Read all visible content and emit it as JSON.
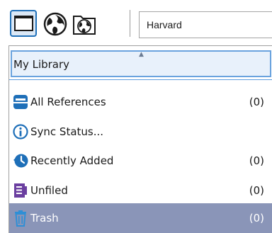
{
  "toolbar": {
    "folder_icon": "folder-window-icon",
    "globe_icon": "globe-icon",
    "globe_alt_icon": "globe-alt-icon",
    "style_value": "Harvard"
  },
  "library": {
    "header": "My Library",
    "sort_indicator": "▲",
    "items": [
      {
        "label": "All References",
        "count": "(0)",
        "icon": "all-references-icon",
        "selected": false
      },
      {
        "label": "Sync Status...",
        "count": "",
        "icon": "info-icon",
        "selected": false
      },
      {
        "label": "Recently Added",
        "count": "(0)",
        "icon": "recently-added-icon",
        "selected": false
      },
      {
        "label": "Unfiled",
        "count": "(0)",
        "icon": "unfiled-icon",
        "selected": false
      },
      {
        "label": "Trash",
        "count": "(0)",
        "icon": "trash-icon",
        "selected": true
      }
    ]
  },
  "colors": {
    "accent": "#1e6fb8",
    "selection": "#8a95b8",
    "unfiled": "#6b3fa0"
  }
}
